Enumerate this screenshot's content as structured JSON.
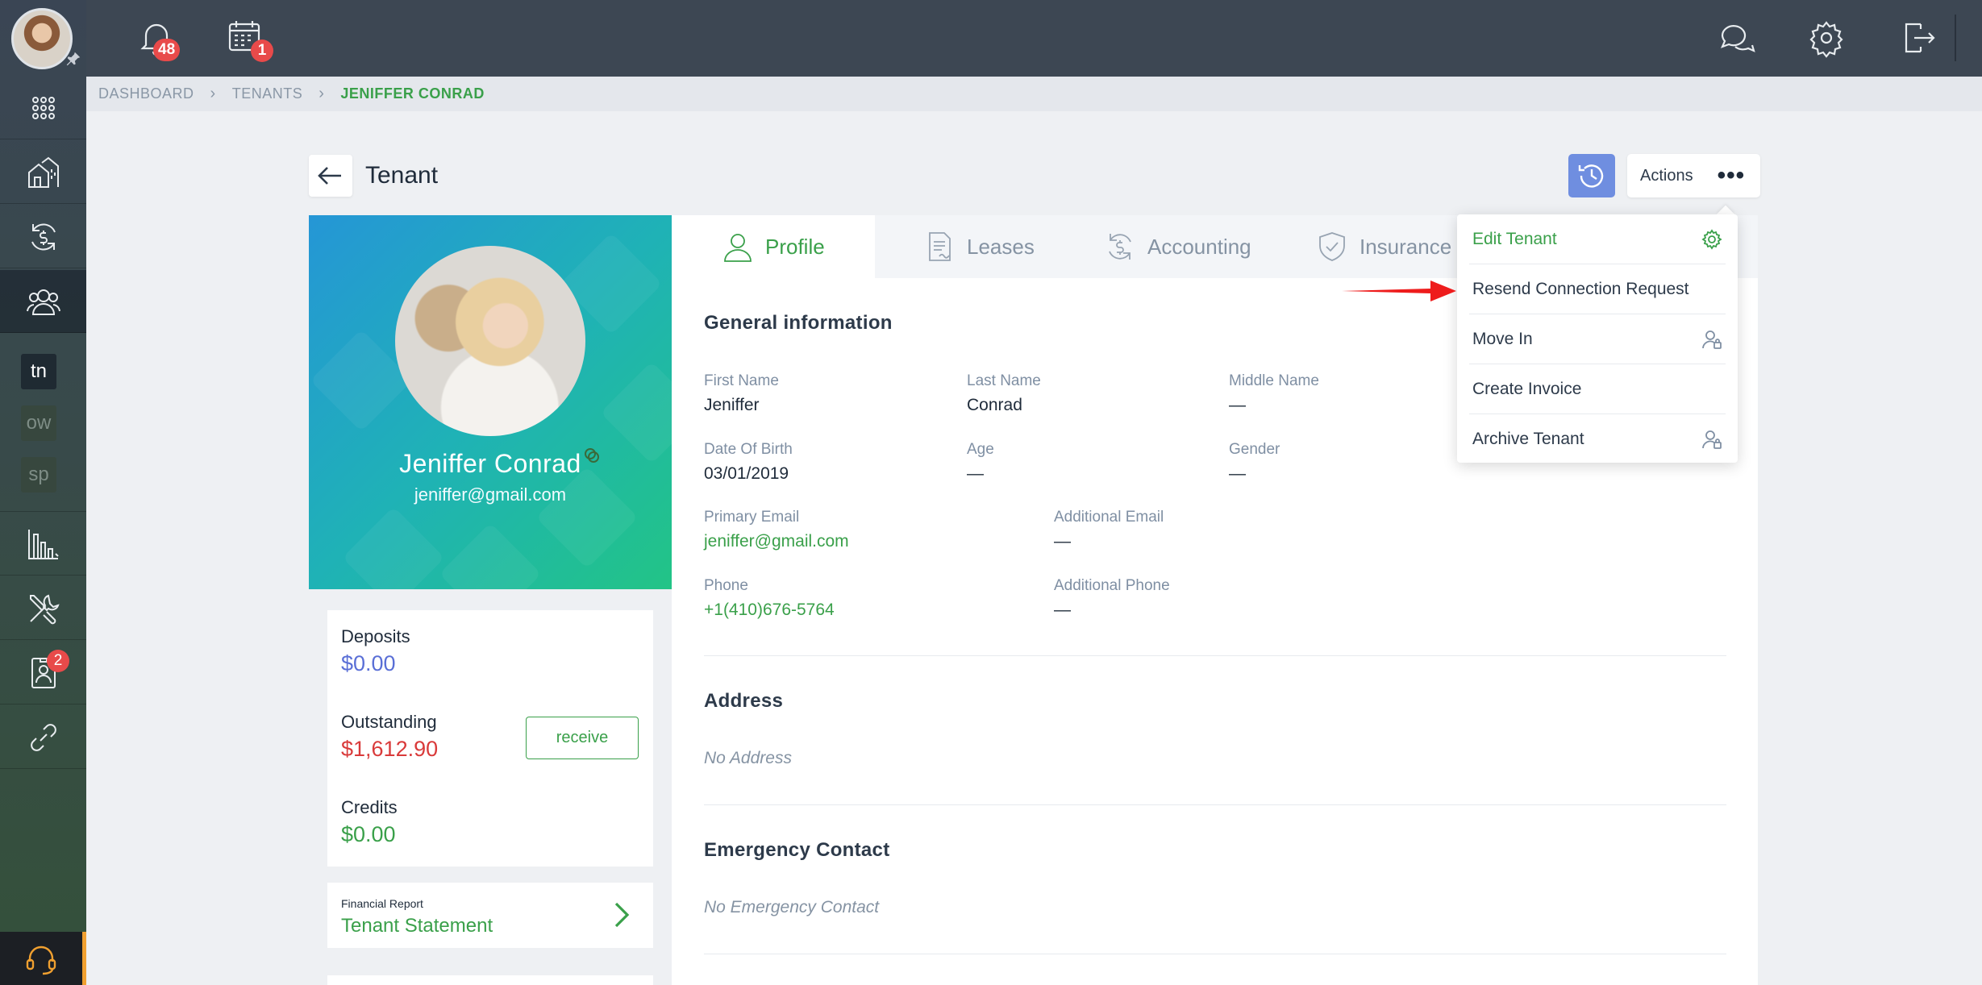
{
  "topbar": {
    "notifications_count": "48",
    "calendar_count": "1"
  },
  "sidebar": {
    "items": [
      {
        "name": "apps"
      },
      {
        "name": "properties"
      },
      {
        "name": "accounting"
      },
      {
        "name": "tenants"
      },
      {
        "name": "reports"
      },
      {
        "name": "maintenance"
      },
      {
        "name": "applications"
      },
      {
        "name": "integrations"
      }
    ],
    "portals": [
      "tn",
      "ow",
      "sp"
    ],
    "applications_badge": "2"
  },
  "breadcrumb": {
    "items": [
      "DASHBOARD",
      "TENANTS",
      "JENIFFER CONRAD"
    ]
  },
  "header": {
    "title": "Tenant",
    "actions_label": "Actions",
    "more_label": "•••"
  },
  "profile_card": {
    "name": "Jeniffer Conrad",
    "email": "jeniffer@gmail.com"
  },
  "balances": {
    "deposits_label": "Deposits",
    "deposits_value": "$0.00",
    "outstanding_label": "Outstanding",
    "outstanding_value": "$1,612.90",
    "receive_label": "receive",
    "credits_label": "Credits",
    "credits_value": "$0.00"
  },
  "financial_report": {
    "small_label": "Financial Report",
    "title": "Tenant Statement"
  },
  "tabs": [
    {
      "label": "Profile",
      "active": true
    },
    {
      "label": "Leases",
      "active": false
    },
    {
      "label": "Accounting",
      "active": false
    },
    {
      "label": "Insurance",
      "active": false
    }
  ],
  "general": {
    "title": "General information",
    "first_name_label": "First Name",
    "first_name": "Jeniffer",
    "last_name_label": "Last Name",
    "last_name": "Conrad",
    "middle_name_label": "Middle Name",
    "middle_name": "—",
    "dob_label": "Date Of Birth",
    "dob": "03/01/2019",
    "age_label": "Age",
    "age": "—",
    "gender_label": "Gender",
    "gender": "—",
    "primary_email_label": "Primary Email",
    "primary_email": "jeniffer@gmail.com",
    "additional_email_label": "Additional Email",
    "additional_email": "—",
    "phone_label": "Phone",
    "phone": "+1(410)676-5764",
    "additional_phone_label": "Additional Phone",
    "additional_phone": "—"
  },
  "address": {
    "title": "Address",
    "empty": "No Address"
  },
  "emergency": {
    "title": "Emergency Contact",
    "empty": "No Emergency Contact"
  },
  "actions_menu": {
    "items": [
      {
        "label": "Edit Tenant",
        "icon": "gear-icon"
      },
      {
        "label": "Resend Connection Request",
        "icon": ""
      },
      {
        "label": "Move In",
        "icon": "user-lock-icon"
      },
      {
        "label": "Create Invoice",
        "icon": ""
      },
      {
        "label": "Archive Tenant",
        "icon": "user-lock-icon"
      }
    ]
  },
  "colors": {
    "accent_green": "#3aa04a",
    "danger_red": "#d93a3a",
    "deposit_blue": "#5a6fd6",
    "history_button": "#6f8ee0",
    "topbar": "#3d4753"
  }
}
